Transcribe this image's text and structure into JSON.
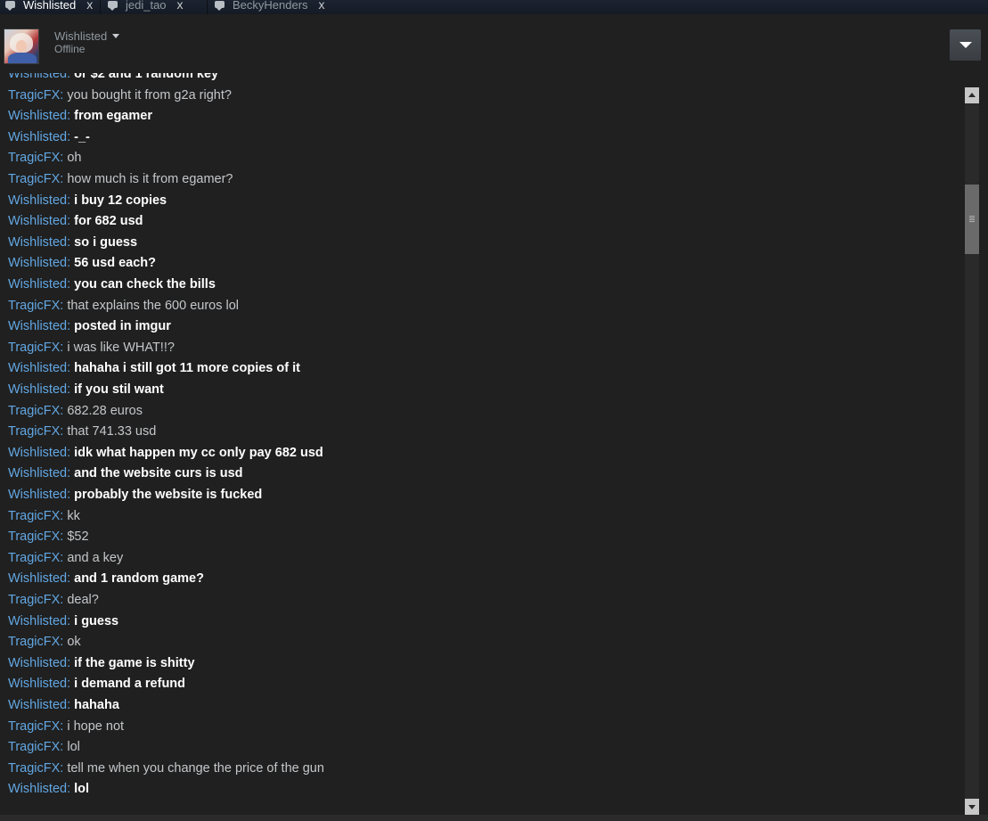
{
  "tabs": [
    {
      "label": "Wishlisted",
      "close": "x",
      "active": true
    },
    {
      "label": "jedi_tao",
      "close": "x",
      "active": false
    },
    {
      "label": "BeckyHenders",
      "close": "x",
      "active": false
    }
  ],
  "header": {
    "friend_name": "Wishlisted",
    "status": "Offline",
    "avatar_icon": "user-avatar",
    "menu_icon": "chevron-down-icon"
  },
  "colors": {
    "sender": "#62a7e3",
    "self_text": "#ffffff",
    "other_text": "#c4c7ca",
    "background": "#202020"
  },
  "messages": [
    {
      "sender": "Wishlisted",
      "text": "or $2 and 1 random key",
      "self": true
    },
    {
      "sender": "TragicFX",
      "text": "you bought it from g2a right?",
      "self": false
    },
    {
      "sender": "Wishlisted",
      "text": "from egamer",
      "self": true
    },
    {
      "sender": "Wishlisted",
      "text": "-_-",
      "self": true
    },
    {
      "sender": "TragicFX",
      "text": "oh",
      "self": false
    },
    {
      "sender": "TragicFX",
      "text": "how much is it from egamer?",
      "self": false
    },
    {
      "sender": "Wishlisted",
      "text": "i buy 12 copies",
      "self": true
    },
    {
      "sender": "Wishlisted",
      "text": "for 682 usd",
      "self": true
    },
    {
      "sender": "Wishlisted",
      "text": "so i guess",
      "self": true
    },
    {
      "sender": "Wishlisted",
      "text": "56 usd each?",
      "self": true
    },
    {
      "sender": "Wishlisted",
      "text": "you can check the bills",
      "self": true
    },
    {
      "sender": "TragicFX",
      "text": "that explains the 600 euros lol",
      "self": false
    },
    {
      "sender": "Wishlisted",
      "text": "posted in imgur",
      "self": true
    },
    {
      "sender": "TragicFX",
      "text": "i was like WHAT!!?",
      "self": false
    },
    {
      "sender": "Wishlisted",
      "text": "hahaha i still got 11 more copies of it",
      "self": true
    },
    {
      "sender": "Wishlisted",
      "text": "if you stil want",
      "self": true
    },
    {
      "sender": "TragicFX",
      "text": "682.28 euros",
      "self": false
    },
    {
      "sender": "TragicFX",
      "text": "that 741.33 usd",
      "self": false
    },
    {
      "sender": "Wishlisted",
      "text": "idk what happen my cc only pay 682 usd",
      "self": true
    },
    {
      "sender": "Wishlisted",
      "text": "and the website curs is usd",
      "self": true
    },
    {
      "sender": "Wishlisted",
      "text": "probably the website is fucked",
      "self": true
    },
    {
      "sender": "TragicFX",
      "text": "kk",
      "self": false
    },
    {
      "sender": "TragicFX",
      "text": "$52",
      "self": false
    },
    {
      "sender": "TragicFX",
      "text": "and a key",
      "self": false
    },
    {
      "sender": "Wishlisted",
      "text": "and 1 random game?",
      "self": true
    },
    {
      "sender": "TragicFX",
      "text": "deal?",
      "self": false
    },
    {
      "sender": "Wishlisted",
      "text": "i guess",
      "self": true
    },
    {
      "sender": "TragicFX",
      "text": "ok",
      "self": false
    },
    {
      "sender": "Wishlisted",
      "text": "if the game is shitty",
      "self": true
    },
    {
      "sender": "Wishlisted",
      "text": "i demand a refund",
      "self": true
    },
    {
      "sender": "Wishlisted",
      "text": "hahaha",
      "self": true
    },
    {
      "sender": "TragicFX",
      "text": "i hope not",
      "self": false
    },
    {
      "sender": "TragicFX",
      "text": "lol",
      "self": false
    },
    {
      "sender": "TragicFX",
      "text": "tell me when you change the price of the gun",
      "self": false
    },
    {
      "sender": "Wishlisted",
      "text": "lol",
      "self": true
    }
  ]
}
